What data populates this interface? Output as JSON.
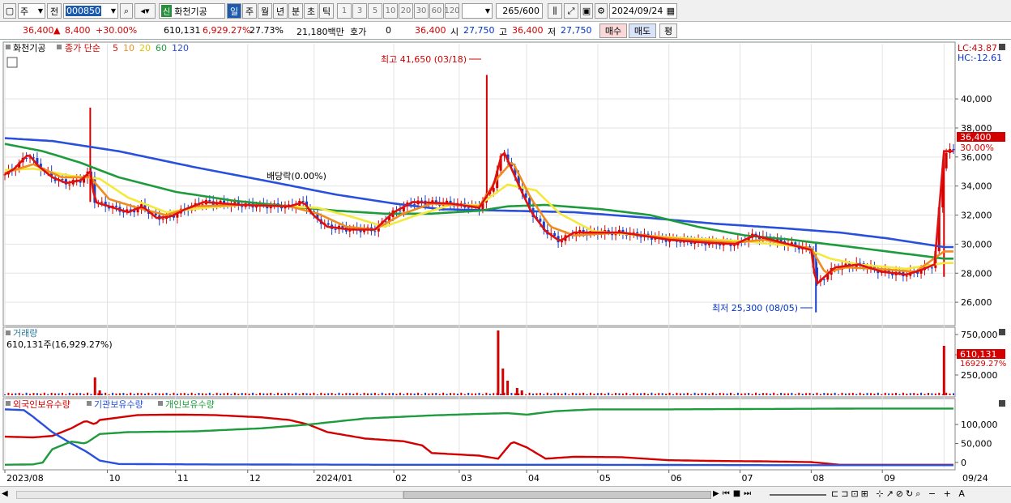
{
  "toolbar": {
    "type_select": "주",
    "prev_label": "전",
    "code_value": "000850",
    "stock_name": "화천기공",
    "badge": "신",
    "periods": [
      "일",
      "주",
      "월",
      "년",
      "분",
      "초",
      "틱"
    ],
    "active_period": "일",
    "intervals": [
      "1",
      "3",
      "5",
      "10",
      "20",
      "30",
      "60",
      "120"
    ],
    "count_value": "265",
    "count_max": "/600",
    "date_value": "2024/09/24"
  },
  "quote": {
    "price": "36,400",
    "change": "8,400",
    "change_pct": "+30.00%",
    "volume": "610,131",
    "volume_ratio": "6,929.27%",
    "turnover": "27.73%",
    "amount": "21,180백만",
    "hoga_label": "호가",
    "hoga_value": "0",
    "hoga_price": "36,400",
    "open_label": "시",
    "open": "27,750",
    "high_label": "고",
    "high": "36,400",
    "low_label": "저",
    "low": "27,750",
    "buy_label": "매수",
    "sell_label": "매도",
    "extra_label": "평"
  },
  "price_panel": {
    "legend_name": "화천기공",
    "legend_ma_label": "종가 단순",
    "ma_periods": [
      "5",
      "10",
      "20",
      "60",
      "120"
    ],
    "ma_colors": [
      "#e01010",
      "#f08c1e",
      "#f5e83c",
      "#1e9b3c",
      "#2850dc"
    ],
    "lc_label": "LC:43.87",
    "hc_label": "HC:-12.61",
    "high_annot": "최고 41,650 (03/18)",
    "low_annot": "최저 25,300 (08/05)",
    "dividend_annot": "배당락(0.00%)",
    "price_tag": "36,400",
    "pct_tag": "30.00%"
  },
  "volume_panel": {
    "title": "거래량",
    "value_label": "610,131주(16,929.27%)",
    "tag_value": "610,131",
    "tag_pct": "16929.27%"
  },
  "holdings_panel": {
    "legend": [
      "외국인보유수량",
      "기관보유수량",
      "개인보유수량"
    ],
    "colors": [
      "#d40000",
      "#2850dc",
      "#1e9b3c"
    ]
  },
  "x_axis": {
    "labels": [
      "2023/08",
      "10",
      "11",
      "12",
      "2024/01",
      "02",
      "03",
      "04",
      "05",
      "06",
      "07",
      "08",
      "09"
    ],
    "right_label": "09/24"
  },
  "chart_data": [
    {
      "type": "line",
      "title": "",
      "ylim": [
        24500,
        43800
      ],
      "y_ticks": [
        26000,
        28000,
        30000,
        32000,
        34000,
        36000,
        38000,
        40000
      ],
      "y_tick_labels": [
        "26,000",
        "28,000",
        "30,000",
        "32,000",
        "34,000",
        "36,000",
        "38,000",
        "40,000"
      ],
      "x_month_positions": [
        0,
        0.108,
        0.18,
        0.256,
        0.326,
        0.41,
        0.479,
        0.55,
        0.625,
        0.7,
        0.775,
        0.85,
        0.925,
        0.99
      ],
      "series": [
        {
          "name": "5",
          "color": "#e01010",
          "keys": [
            [
              0,
              34800
            ],
            [
              0.01,
              35200
            ],
            [
              0.025,
              36200
            ],
            [
              0.035,
              35400
            ],
            [
              0.05,
              34600
            ],
            [
              0.065,
              34200
            ],
            [
              0.08,
              34400
            ],
            [
              0.09,
              35000
            ],
            [
              0.095,
              32900
            ],
            [
              0.11,
              32600
            ],
            [
              0.13,
              32200
            ],
            [
              0.145,
              32600
            ],
            [
              0.16,
              31800
            ],
            [
              0.175,
              31900
            ],
            [
              0.19,
              32400
            ],
            [
              0.21,
              32900
            ],
            [
              0.25,
              32700
            ],
            [
              0.3,
              32600
            ],
            [
              0.315,
              32900
            ],
            [
              0.325,
              32000
            ],
            [
              0.34,
              31200
            ],
            [
              0.365,
              31000
            ],
            [
              0.39,
              31000
            ],
            [
              0.41,
              32200
            ],
            [
              0.43,
              32900
            ],
            [
              0.47,
              32800
            ],
            [
              0.5,
              32500
            ],
            [
              0.515,
              34000
            ],
            [
              0.525,
              36500
            ],
            [
              0.53,
              35800
            ],
            [
              0.545,
              33600
            ],
            [
              0.555,
              32200
            ],
            [
              0.57,
              30900
            ],
            [
              0.585,
              30200
            ],
            [
              0.6,
              30800
            ],
            [
              0.65,
              30800
            ],
            [
              0.7,
              30300
            ],
            [
              0.74,
              30100
            ],
            [
              0.77,
              30000
            ],
            [
              0.79,
              30600
            ],
            [
              0.82,
              30100
            ],
            [
              0.85,
              29600
            ],
            [
              0.855,
              27200
            ],
            [
              0.875,
              28400
            ],
            [
              0.9,
              28600
            ],
            [
              0.925,
              28100
            ],
            [
              0.95,
              27900
            ],
            [
              0.965,
              28200
            ],
            [
              0.98,
              28600
            ],
            [
              0.99,
              36400
            ]
          ]
        },
        {
          "name": "10",
          "color": "#f08c1e",
          "keys": [
            [
              0,
              34900
            ],
            [
              0.03,
              35500
            ],
            [
              0.06,
              34600
            ],
            [
              0.09,
              34600
            ],
            [
              0.11,
              33100
            ],
            [
              0.14,
              32500
            ],
            [
              0.17,
              32000
            ],
            [
              0.2,
              32600
            ],
            [
              0.25,
              32700
            ],
            [
              0.3,
              32600
            ],
            [
              0.33,
              32100
            ],
            [
              0.36,
              31200
            ],
            [
              0.39,
              31000
            ],
            [
              0.42,
              32100
            ],
            [
              0.45,
              32800
            ],
            [
              0.5,
              32600
            ],
            [
              0.52,
              34600
            ],
            [
              0.535,
              35700
            ],
            [
              0.555,
              33100
            ],
            [
              0.575,
              31200
            ],
            [
              0.6,
              30600
            ],
            [
              0.65,
              30800
            ],
            [
              0.7,
              30400
            ],
            [
              0.77,
              30100
            ],
            [
              0.8,
              30300
            ],
            [
              0.85,
              29700
            ],
            [
              0.865,
              28000
            ],
            [
              0.885,
              28400
            ],
            [
              0.92,
              28300
            ],
            [
              0.96,
              28100
            ],
            [
              0.99,
              29500
            ]
          ]
        },
        {
          "name": "20",
          "color": "#f5e83c",
          "keys": [
            [
              0,
              35100
            ],
            [
              0.03,
              35200
            ],
            [
              0.07,
              34700
            ],
            [
              0.1,
              34500
            ],
            [
              0.13,
              33200
            ],
            [
              0.17,
              32200
            ],
            [
              0.21,
              32500
            ],
            [
              0.25,
              32700
            ],
            [
              0.3,
              32600
            ],
            [
              0.33,
              32500
            ],
            [
              0.37,
              31800
            ],
            [
              0.4,
              31200
            ],
            [
              0.43,
              31900
            ],
            [
              0.47,
              32700
            ],
            [
              0.5,
              32700
            ],
            [
              0.53,
              34100
            ],
            [
              0.56,
              33700
            ],
            [
              0.585,
              32100
            ],
            [
              0.62,
              30900
            ],
            [
              0.67,
              30600
            ],
            [
              0.72,
              30400
            ],
            [
              0.78,
              30200
            ],
            [
              0.84,
              29800
            ],
            [
              0.87,
              29000
            ],
            [
              0.9,
              28600
            ],
            [
              0.95,
              28300
            ],
            [
              0.99,
              28700
            ]
          ]
        },
        {
          "name": "60",
          "color": "#1e9b3c",
          "keys": [
            [
              0,
              36900
            ],
            [
              0.04,
              36400
            ],
            [
              0.08,
              35600
            ],
            [
              0.12,
              34600
            ],
            [
              0.18,
              33600
            ],
            [
              0.24,
              33000
            ],
            [
              0.3,
              32600
            ],
            [
              0.35,
              32300
            ],
            [
              0.4,
              32100
            ],
            [
              0.45,
              32100
            ],
            [
              0.5,
              32300
            ],
            [
              0.53,
              32600
            ],
            [
              0.57,
              32700
            ],
            [
              0.63,
              32400
            ],
            [
              0.68,
              32000
            ],
            [
              0.73,
              31200
            ],
            [
              0.78,
              30600
            ],
            [
              0.83,
              30300
            ],
            [
              0.88,
              29900
            ],
            [
              0.93,
              29500
            ],
            [
              0.99,
              29000
            ]
          ]
        },
        {
          "name": "120",
          "color": "#2850dc",
          "keys": [
            [
              0,
              37300
            ],
            [
              0.05,
              37100
            ],
            [
              0.12,
              36400
            ],
            [
              0.2,
              35300
            ],
            [
              0.28,
              34300
            ],
            [
              0.35,
              33400
            ],
            [
              0.41,
              32800
            ],
            [
              0.46,
              32400
            ],
            [
              0.53,
              32300
            ],
            [
              0.6,
              32200
            ],
            [
              0.68,
              31800
            ],
            [
              0.75,
              31400
            ],
            [
              0.82,
              31100
            ],
            [
              0.88,
              30800
            ],
            [
              0.93,
              30400
            ],
            [
              0.99,
              29800
            ]
          ]
        }
      ]
    },
    {
      "type": "bar",
      "title": "",
      "ylim": [
        0,
        820000
      ],
      "y_ticks": [
        250000,
        500000,
        750000
      ],
      "y_tick_labels": [
        "250,000",
        "500,000",
        "750,000"
      ],
      "spikes": [
        [
          0.095,
          220000
        ],
        [
          0.1,
          60000
        ],
        [
          0.52,
          800000
        ],
        [
          0.525,
          330000
        ],
        [
          0.53,
          180000
        ],
        [
          0.54,
          90000
        ],
        [
          0.545,
          60000
        ],
        [
          0.99,
          610131
        ]
      ],
      "base_volume": 20000
    },
    {
      "type": "line",
      "title": "",
      "ylim": [
        -15000,
        160000
      ],
      "y_ticks": [
        0,
        50000,
        100000
      ],
      "y_tick_labels": [
        "0",
        "50,000",
        "100,000"
      ],
      "series": [
        {
          "name": "외국인보유수량",
          "color": "#d40000",
          "keys": [
            [
              0,
              68000
            ],
            [
              0.03,
              66000
            ],
            [
              0.05,
              70000
            ],
            [
              0.07,
              90000
            ],
            [
              0.085,
              110000
            ],
            [
              0.095,
              100000
            ],
            [
              0.1,
              112000
            ],
            [
              0.14,
              125000
            ],
            [
              0.18,
              126000
            ],
            [
              0.22,
              125000
            ],
            [
              0.27,
              119000
            ],
            [
              0.3,
              112000
            ],
            [
              0.32,
              100000
            ],
            [
              0.34,
              80000
            ],
            [
              0.38,
              63000
            ],
            [
              0.42,
              56000
            ],
            [
              0.44,
              45000
            ],
            [
              0.45,
              25000
            ],
            [
              0.5,
              18000
            ],
            [
              0.52,
              10000
            ],
            [
              0.535,
              55000
            ],
            [
              0.55,
              40000
            ],
            [
              0.57,
              10000
            ],
            [
              0.6,
              15000
            ],
            [
              0.65,
              14000
            ],
            [
              0.7,
              6000
            ],
            [
              0.75,
              4000
            ],
            [
              0.8,
              3000
            ],
            [
              0.85,
              1000
            ],
            [
              0.88,
              -6000
            ],
            [
              0.92,
              -6000
            ],
            [
              0.99,
              -6000
            ]
          ]
        },
        {
          "name": "기관보유수량",
          "color": "#2850dc",
          "keys": [
            [
              0,
              140000
            ],
            [
              0.02,
              138000
            ],
            [
              0.03,
              120000
            ],
            [
              0.05,
              80000
            ],
            [
              0.07,
              50000
            ],
            [
              0.085,
              30000
            ],
            [
              0.1,
              5000
            ],
            [
              0.12,
              -4000
            ],
            [
              0.2,
              -5000
            ],
            [
              0.4,
              -6000
            ],
            [
              0.6,
              -6000
            ],
            [
              0.8,
              -7000
            ],
            [
              0.99,
              -7000
            ]
          ]
        },
        {
          "name": "개인보유수량",
          "color": "#1e9b3c",
          "keys": [
            [
              0,
              -6000
            ],
            [
              0.03,
              -5000
            ],
            [
              0.04,
              0
            ],
            [
              0.05,
              35000
            ],
            [
              0.07,
              55000
            ],
            [
              0.085,
              50000
            ],
            [
              0.1,
              75000
            ],
            [
              0.13,
              80000
            ],
            [
              0.2,
              82000
            ],
            [
              0.27,
              90000
            ],
            [
              0.32,
              100000
            ],
            [
              0.38,
              116000
            ],
            [
              0.45,
              124000
            ],
            [
              0.5,
              128000
            ],
            [
              0.53,
              130000
            ],
            [
              0.55,
              126000
            ],
            [
              0.58,
              135000
            ],
            [
              0.62,
              140000
            ],
            [
              0.7,
              140000
            ],
            [
              0.8,
              141000
            ],
            [
              0.9,
              142000
            ],
            [
              0.99,
              142000
            ]
          ]
        }
      ]
    }
  ]
}
